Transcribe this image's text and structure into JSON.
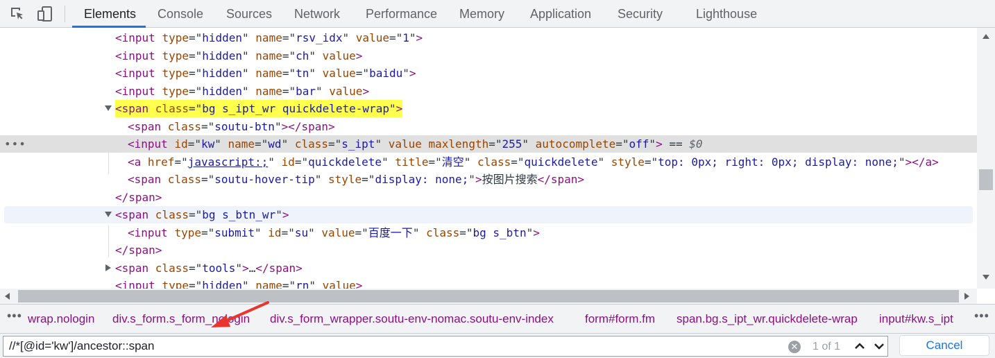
{
  "toolbar": {
    "tabs": [
      "Elements",
      "Console",
      "Sources",
      "Network",
      "Performance",
      "Memory",
      "Application",
      "Security",
      "Lighthouse"
    ],
    "active_tab": "Elements"
  },
  "dom_tree": {
    "lines": [
      [
        [
          "t",
          "<input "
        ],
        [
          "a",
          "type"
        ],
        [
          "p",
          "=\""
        ],
        [
          "v",
          "hidden"
        ],
        [
          "p",
          "\" "
        ],
        [
          "a",
          "name"
        ],
        [
          "p",
          "=\""
        ],
        [
          "v",
          "rsv_idx"
        ],
        [
          "p",
          "\" "
        ],
        [
          "a",
          "value"
        ],
        [
          "p",
          "=\""
        ],
        [
          "v",
          "1"
        ],
        [
          "p",
          "\""
        ],
        [
          "t",
          ">"
        ]
      ],
      [
        [
          "t",
          "<input "
        ],
        [
          "a",
          "type"
        ],
        [
          "p",
          "=\""
        ],
        [
          "v",
          "hidden"
        ],
        [
          "p",
          "\" "
        ],
        [
          "a",
          "name"
        ],
        [
          "p",
          "=\""
        ],
        [
          "v",
          "ch"
        ],
        [
          "p",
          "\" "
        ],
        [
          "a",
          "value"
        ],
        [
          "t",
          ">"
        ]
      ],
      [
        [
          "t",
          "<input "
        ],
        [
          "a",
          "type"
        ],
        [
          "p",
          "=\""
        ],
        [
          "v",
          "hidden"
        ],
        [
          "p",
          "\" "
        ],
        [
          "a",
          "name"
        ],
        [
          "p",
          "=\""
        ],
        [
          "v",
          "tn"
        ],
        [
          "p",
          "\" "
        ],
        [
          "a",
          "value"
        ],
        [
          "p",
          "=\""
        ],
        [
          "v",
          "baidu"
        ],
        [
          "p",
          "\""
        ],
        [
          "t",
          ">"
        ]
      ],
      [
        [
          "t",
          "<input "
        ],
        [
          "a",
          "type"
        ],
        [
          "p",
          "=\""
        ],
        [
          "v",
          "hidden"
        ],
        [
          "p",
          "\" "
        ],
        [
          "a",
          "name"
        ],
        [
          "p",
          "=\""
        ],
        [
          "v",
          "bar"
        ],
        [
          "p",
          "\" "
        ],
        [
          "a",
          "value"
        ],
        [
          "t",
          ">"
        ]
      ],
      [
        [
          "t",
          "<span "
        ],
        [
          "a",
          "class"
        ],
        [
          "p",
          "=\""
        ],
        [
          "v",
          "bg s_ipt_wr quickdelete-wrap"
        ],
        [
          "p",
          "\""
        ],
        [
          "t",
          ">"
        ]
      ],
      [
        [
          "t",
          "<span "
        ],
        [
          "a",
          "class"
        ],
        [
          "p",
          "=\""
        ],
        [
          "v",
          "soutu-btn"
        ],
        [
          "p",
          "\""
        ],
        [
          "t",
          "></span>"
        ]
      ],
      [
        [
          "t",
          "<input "
        ],
        [
          "a",
          "id"
        ],
        [
          "p",
          "=\""
        ],
        [
          "v",
          "kw"
        ],
        [
          "p",
          "\" "
        ],
        [
          "a",
          "name"
        ],
        [
          "p",
          "=\""
        ],
        [
          "v",
          "wd"
        ],
        [
          "p",
          "\" "
        ],
        [
          "a",
          "class"
        ],
        [
          "p",
          "=\""
        ],
        [
          "v",
          "s_ipt"
        ],
        [
          "p",
          "\" "
        ],
        [
          "a",
          "value"
        ],
        [
          "p",
          " "
        ],
        [
          "a",
          "maxlength"
        ],
        [
          "p",
          "=\""
        ],
        [
          "v",
          "255"
        ],
        [
          "p",
          "\" "
        ],
        [
          "a",
          "autocomplete"
        ],
        [
          "p",
          "=\""
        ],
        [
          "v",
          "off"
        ],
        [
          "p",
          "\""
        ],
        [
          "t",
          ">"
        ],
        [
          "p",
          " == "
        ],
        [
          "d",
          "$0"
        ]
      ],
      [
        [
          "t",
          "<a "
        ],
        [
          "a",
          "href"
        ],
        [
          "p",
          "=\""
        ],
        [
          "l",
          "javascript:;"
        ],
        [
          "p",
          "\" "
        ],
        [
          "a",
          "id"
        ],
        [
          "p",
          "=\""
        ],
        [
          "v",
          "quickdelete"
        ],
        [
          "p",
          "\" "
        ],
        [
          "a",
          "title"
        ],
        [
          "p",
          "=\""
        ],
        [
          "v",
          "清空"
        ],
        [
          "p",
          "\" "
        ],
        [
          "a",
          "class"
        ],
        [
          "p",
          "=\""
        ],
        [
          "v",
          "quickdelete"
        ],
        [
          "p",
          "\" "
        ],
        [
          "a",
          "style"
        ],
        [
          "p",
          "=\""
        ],
        [
          "v",
          "top: 0px; right: 0px; display: none;"
        ],
        [
          "p",
          "\""
        ],
        [
          "t",
          "></a>"
        ]
      ],
      [
        [
          "t",
          "<span "
        ],
        [
          "a",
          "class"
        ],
        [
          "p",
          "=\""
        ],
        [
          "v",
          "soutu-hover-tip"
        ],
        [
          "p",
          "\" "
        ],
        [
          "a",
          "style"
        ],
        [
          "p",
          "=\""
        ],
        [
          "v",
          "display: none;"
        ],
        [
          "p",
          "\""
        ],
        [
          "t",
          ">"
        ],
        [
          "p",
          "按图片搜索"
        ],
        [
          "t",
          "</span>"
        ]
      ],
      [
        [
          "t",
          "</span>"
        ]
      ],
      [
        [
          "t",
          "<span "
        ],
        [
          "a",
          "class"
        ],
        [
          "p",
          "=\""
        ],
        [
          "v",
          "bg s_btn_wr"
        ],
        [
          "p",
          "\""
        ],
        [
          "t",
          ">"
        ]
      ],
      [
        [
          "t",
          "<input "
        ],
        [
          "a",
          "type"
        ],
        [
          "p",
          "=\""
        ],
        [
          "v",
          "submit"
        ],
        [
          "p",
          "\" "
        ],
        [
          "a",
          "id"
        ],
        [
          "p",
          "=\""
        ],
        [
          "v",
          "su"
        ],
        [
          "p",
          "\" "
        ],
        [
          "a",
          "value"
        ],
        [
          "p",
          "=\""
        ],
        [
          "v",
          "百度一下"
        ],
        [
          "p",
          "\" "
        ],
        [
          "a",
          "class"
        ],
        [
          "p",
          "=\""
        ],
        [
          "v",
          "bg s_btn"
        ],
        [
          "p",
          "\""
        ],
        [
          "t",
          ">"
        ]
      ],
      [
        [
          "t",
          "</span>"
        ]
      ],
      [
        [
          "t",
          "<span "
        ],
        [
          "a",
          "class"
        ],
        [
          "p",
          "=\""
        ],
        [
          "v",
          "tools"
        ],
        [
          "p",
          "\""
        ],
        [
          "t",
          ">"
        ],
        [
          "p",
          "…"
        ],
        [
          "t",
          "</span>"
        ]
      ],
      [
        [
          "t",
          "<input "
        ],
        [
          "a",
          "type"
        ],
        [
          "p",
          "=\""
        ],
        [
          "v",
          "hidden"
        ],
        [
          "p",
          "\" "
        ],
        [
          "a",
          "name"
        ],
        [
          "p",
          "=\""
        ],
        [
          "v",
          "rn"
        ],
        [
          "p",
          "\" "
        ],
        [
          "a",
          "value"
        ],
        [
          "t",
          ">"
        ]
      ]
    ]
  },
  "breadcrumbs": {
    "items": [
      "wrap.nologin",
      "div.s_form.s_form_nologin",
      "div.s_form_wrapper.soutu-env-nomac.soutu-env-index",
      "form#form.fm",
      "span.bg.s_ipt_wr.quickdelete-wrap",
      "input#kw.s_ipt"
    ]
  },
  "search": {
    "value": "//*[@id='kw']/ancestor::span",
    "match_count": "1 of 1",
    "cancel_label": "Cancel"
  },
  "colors": {
    "highlight": "#ffff4d",
    "accent": "#1a73e8",
    "annotation_arrow": "#e8352d"
  }
}
